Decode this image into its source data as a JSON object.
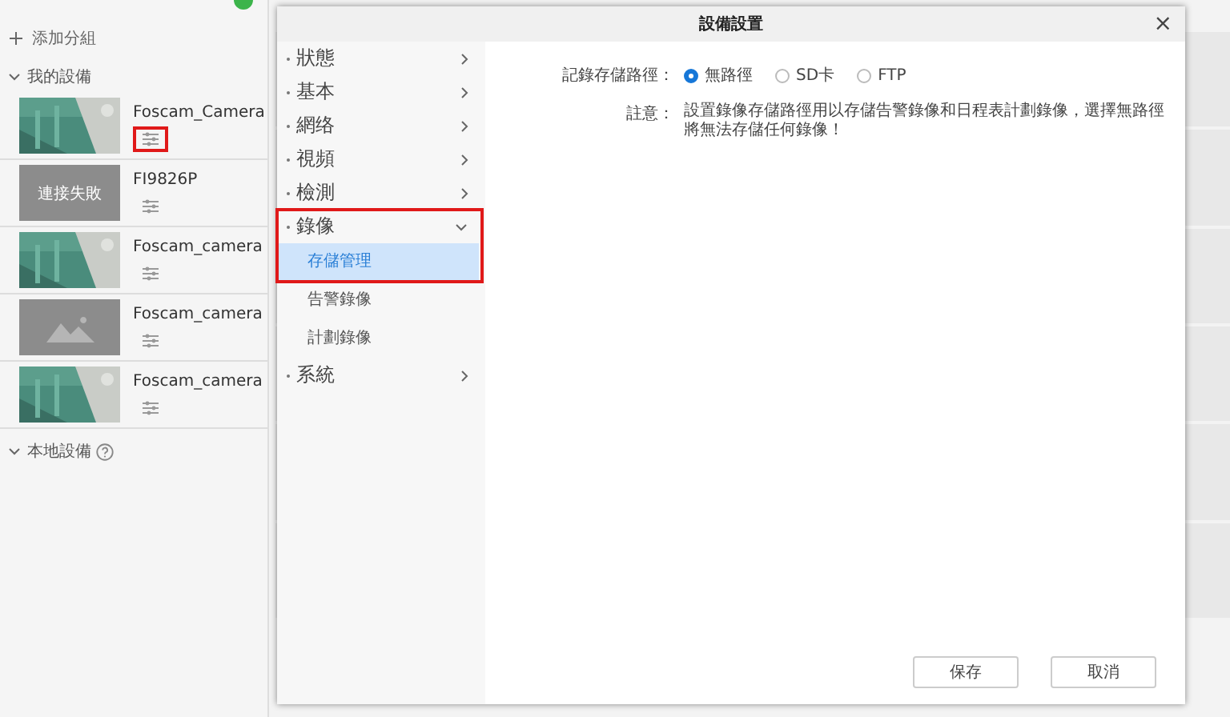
{
  "sidebar": {
    "add_group": "添加分組",
    "groups": [
      {
        "label": "我的設備",
        "expanded": true
      },
      {
        "label": "本地設備",
        "expanded": true
      }
    ],
    "devices": [
      {
        "name": "Foscam_Camera",
        "kind": "picture",
        "highlighted": true
      },
      {
        "name": "FI9826P",
        "kind": "failed",
        "status": "連接失敗",
        "highlighted": false
      },
      {
        "name": "Foscam_camera",
        "kind": "picture",
        "highlighted": false
      },
      {
        "name": "Foscam_camera",
        "kind": "placeholder",
        "highlighted": false
      },
      {
        "name": "Foscam_camera",
        "kind": "picture",
        "highlighted": false
      }
    ]
  },
  "dialog": {
    "title": "設備設置",
    "close": "×",
    "menu": [
      {
        "label": "狀態",
        "expanded": false,
        "highlighted": false
      },
      {
        "label": "基本",
        "expanded": false,
        "highlighted": false
      },
      {
        "label": "網络",
        "expanded": false,
        "highlighted": false
      },
      {
        "label": "視頻",
        "expanded": false,
        "highlighted": false
      },
      {
        "label": "檢測",
        "expanded": false,
        "highlighted": false
      },
      {
        "label": "錄像",
        "expanded": true,
        "highlighted": true,
        "children": [
          {
            "label": "存儲管理",
            "selected": true
          },
          {
            "label": "告警錄像",
            "selected": false
          },
          {
            "label": "計劃錄像",
            "selected": false
          }
        ]
      },
      {
        "label": "系統",
        "expanded": false,
        "highlighted": false
      }
    ],
    "path_label": "記錄存儲路徑：",
    "path_options": [
      {
        "label": "無路徑",
        "selected": true
      },
      {
        "label": "SD卡",
        "selected": false
      },
      {
        "label": "FTP",
        "selected": false
      }
    ],
    "note_label": "註意：",
    "note": "設置錄像存儲路徑用以存儲告警錄像和日程表計劃錄像，選擇無路徑將無法存儲任何錄像！",
    "buttons": [
      "保存",
      "取消"
    ]
  }
}
